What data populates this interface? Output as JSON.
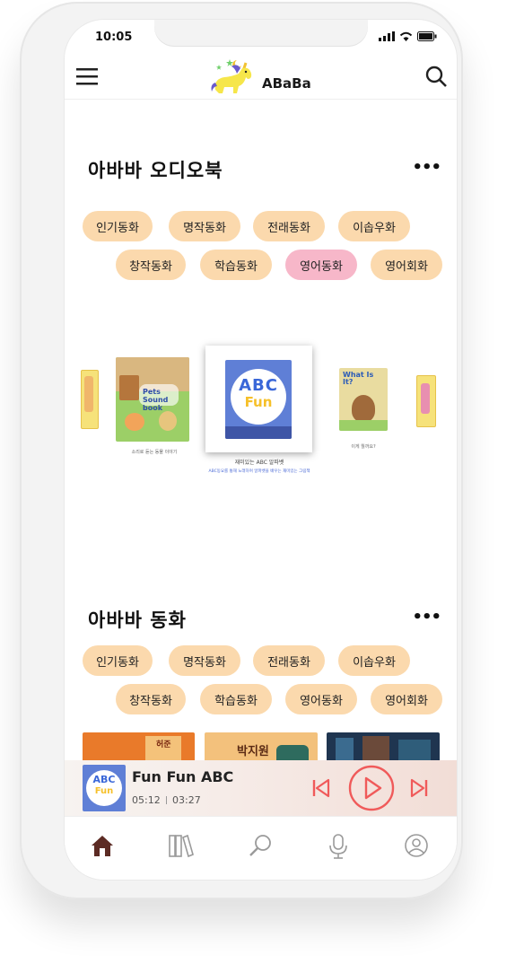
{
  "status": {
    "time": "10:05"
  },
  "header": {
    "logo_text": "ABaBa"
  },
  "audiobook": {
    "title": "아바바 오디오북",
    "more": "•••",
    "categories": [
      "인기동화",
      "명작동화",
      "전래동화",
      "이솝우화",
      "창작동화",
      "학습동화",
      "영어동화",
      "영어회화"
    ],
    "active_category": "영어동화",
    "featured": {
      "cover_title_line1": "ABC",
      "cover_title_line2": "Fun",
      "caption": "재미있는 ABC 알파벳",
      "sub_caption": "ABC동요를 통해 노래하며 알파벳을 배우는 재미있는 그림책"
    },
    "side_books": [
      {
        "cover": "Pets Sound book",
        "caption": "소리로 듣는 동물 이야기"
      },
      {
        "cover": "What Is It?",
        "caption": "이게 뭘까요?"
      }
    ]
  },
  "fairytale": {
    "title": "아바바 동화",
    "more": "•••",
    "categories": [
      "인기동화",
      "명작동화",
      "전래동화",
      "이솝우화",
      "창작동화",
      "학습동화",
      "영어동화",
      "영어회화"
    ],
    "thumbs": [
      {
        "text": "허준"
      },
      {
        "text": "박지원"
      },
      {
        "text": ""
      }
    ]
  },
  "player": {
    "track_title": "Fun Fun ABC",
    "current_time": "05:12",
    "total_time": "03:27",
    "thumb_text_1": "ABC",
    "thumb_text_2": "Fun",
    "progress": 0.0
  },
  "tabbar": {
    "items": [
      "home-icon",
      "library-icon",
      "search-icon",
      "microphone-icon",
      "profile-icon"
    ],
    "active": "home-icon"
  },
  "colors": {
    "chip": "#fbd9ad",
    "chip_active": "#f7b7c9",
    "player_accent": "#f05a5a",
    "home_active": "#5c2b24"
  }
}
